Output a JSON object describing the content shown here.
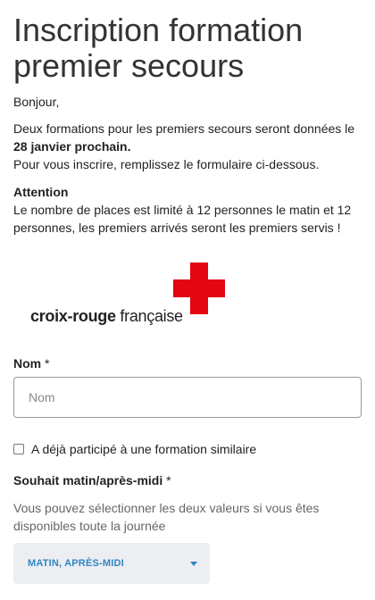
{
  "form": {
    "title": "Inscription formation premier secours",
    "greeting": "Bonjour,",
    "intro_line1": "Deux formations pour les premiers secours seront données le",
    "intro_date": "28 janvier prochain.",
    "intro_line2": "Pour vous inscrire, remplissez le formulaire ci-dessous.",
    "attention_heading": "Attention",
    "attention_text": "Le nombre de places est limité à 12 personnes le matin et 12 personnes, les premiers arrivés seront les premiers servis !"
  },
  "logo": {
    "brand_bold": "croix-rouge",
    "brand_light": "française",
    "cross_color": "#e30613"
  },
  "fields": {
    "name": {
      "label": "Nom",
      "required_mark": "*",
      "placeholder": "Nom",
      "value": ""
    },
    "prior_training": {
      "label": "A déjà participé à une formation similaire",
      "checked": false
    },
    "time_preference": {
      "label": "Souhait matin/après-midi",
      "required_mark": "*",
      "helper": "Vous pouvez sélectionner les deux valeurs si vous êtes disponibles toute la journée",
      "selected_value": "MATIN, APRÈS-MIDI"
    }
  },
  "colors": {
    "accent": "#2f86c4",
    "select_bg": "#eceef2"
  }
}
